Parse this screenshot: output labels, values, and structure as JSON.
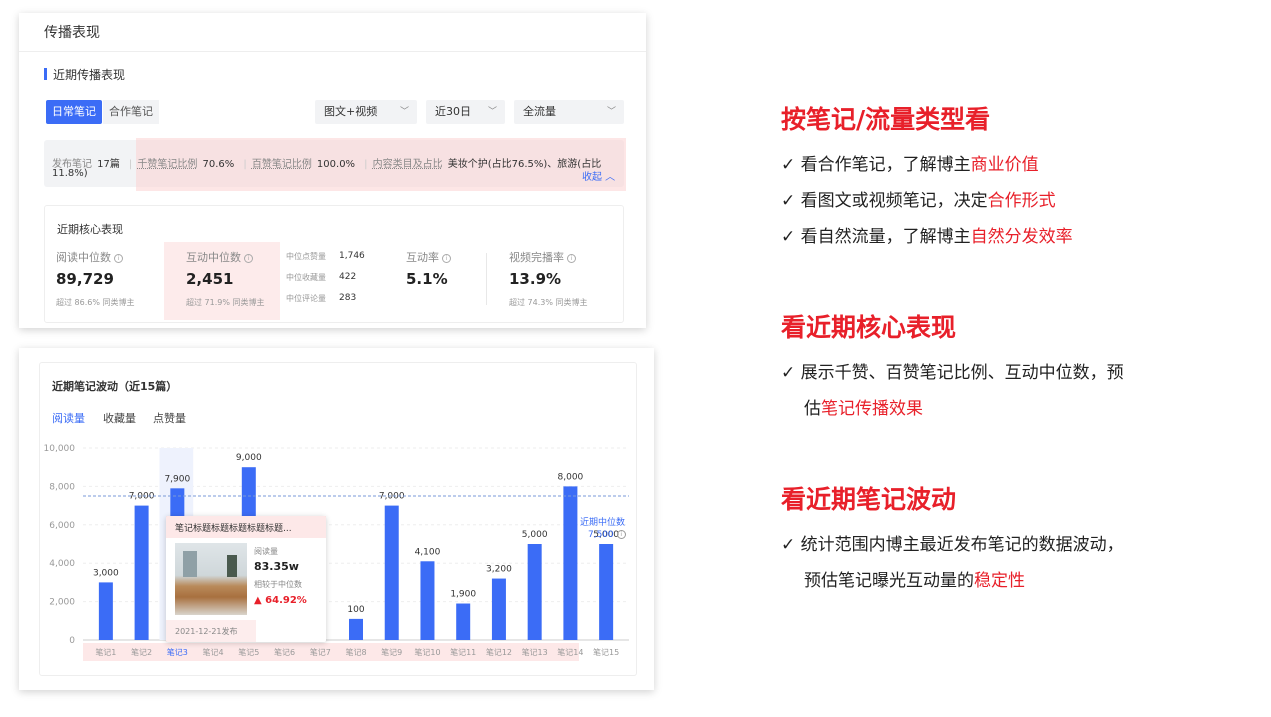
{
  "card1": {
    "title": "传播表现",
    "section_title": "近期传播表现",
    "tabs": [
      "日常笔记",
      "合作笔记"
    ],
    "filters": [
      "图文+视频",
      "近30日",
      "全流量"
    ],
    "pub": {
      "label1": "发布笔记",
      "value1": "17篇",
      "label2": "千赞笔记比例",
      "value2": "70.6%",
      "label3": "百赞笔记比例",
      "value3": "100.0%",
      "label4": "内容类目及占比",
      "value4": "美妆个护(占比76.5%)、旅游(占比",
      "value4b": "11.8%)",
      "collapse": "收起 ︿"
    },
    "core": {
      "title": "近期核心表现",
      "read_label": "阅读中位数",
      "read_value": "89,729",
      "read_sub": "超过 86.6% 同类博主",
      "inter_label": "互动中位数",
      "inter_value": "2,451",
      "inter_sub": "超过 71.9% 同类博主",
      "likes_label": "中位点赞量",
      "likes_value": "1,746",
      "fav_label": "中位收藏量",
      "fav_value": "422",
      "cmt_label": "中位评论量",
      "cmt_value": "283",
      "rate_label": "互动率",
      "rate_value": "5.1%",
      "video_label": "视频完播率",
      "video_value": "13.9%",
      "video_sub": "超过 74.3% 同类博主"
    }
  },
  "card2": {
    "title": "近期笔记波动（近15篇）",
    "tabs": [
      "阅读量",
      "收藏量",
      "点赞量"
    ],
    "median_label": "近期中位数",
    "median_value": "7,500",
    "tooltip": {
      "title": "笔记标题标题标题标题标题...",
      "metric_label": "阅读量",
      "metric_value": "83.35w",
      "compare_label": "相较于中位数",
      "compare_value": "▲ 64.92%",
      "date": "2021-12-21发布"
    }
  },
  "chart_data": {
    "type": "bar",
    "categories": [
      "笔记1",
      "笔记2",
      "笔记3",
      "笔记4",
      "笔记5",
      "笔记6",
      "笔记7",
      "笔记8",
      "笔记9",
      "笔记10",
      "笔记11",
      "笔记12",
      "笔记13",
      "笔记14",
      "笔记15"
    ],
    "values": [
      3000,
      7000,
      7900,
      null,
      9000,
      null,
      null,
      1100,
      7000,
      4100,
      1900,
      3200,
      5000,
      8000,
      5000
    ],
    "data_labels": [
      "3,000",
      "7,000",
      "7,900",
      "",
      "9,000",
      "",
      "",
      "100",
      "7,000",
      "4,100",
      "1,900",
      "3,200",
      "5,000",
      "8,000",
      "5,000"
    ],
    "ylim": [
      0,
      10000
    ],
    "yticks": [
      "0",
      "2,000",
      "4,000",
      "6,000",
      "8,000",
      "10,000"
    ],
    "median": 7500,
    "highlight_index": 2,
    "color": "#3b6cf6"
  },
  "right": {
    "h1": "按笔记/流量类型看",
    "l1a": "看合作笔记，了解博主",
    "l1b": "商业价值",
    "l2a": "看图文或视频笔记，决定",
    "l2b": "合作形式",
    "l3a": "看自然流量，了解博主",
    "l3b": "自然分发效率",
    "h2": "看近期核心表现",
    "l4a": "展示千赞、百赞笔记比例、互动中位数，预",
    "l4b": "估",
    "l4c": "笔记传播效果",
    "h3": "看近期笔记波动",
    "l5a": "统计范围内博主最近发布笔记的数据波动，",
    "l5b": "预估笔记曝光互动量的",
    "l5c": "稳定性",
    "check": "✓"
  }
}
